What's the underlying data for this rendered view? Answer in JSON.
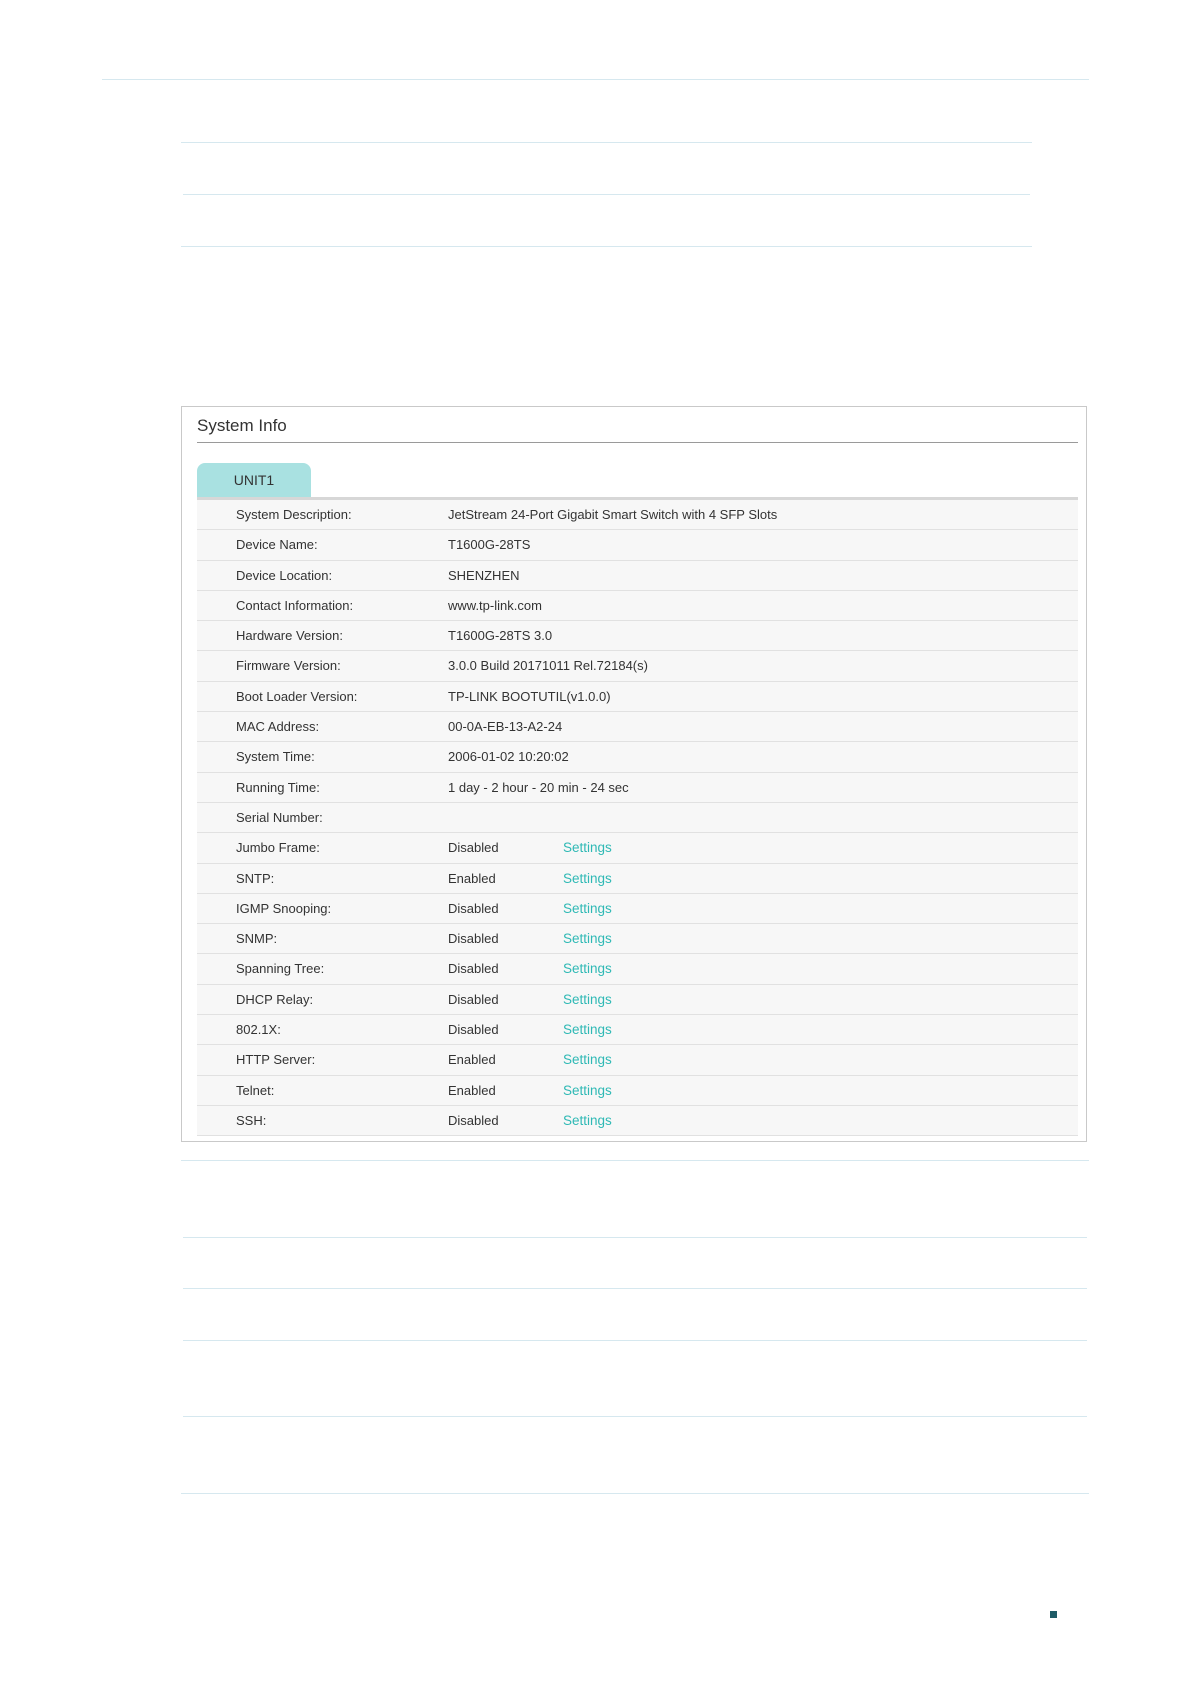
{
  "panel": {
    "title": "System Info",
    "tab_label": "UNIT1"
  },
  "rows": [
    {
      "label": "System Description:",
      "value": "JetStream 24-Port Gigabit Smart Switch with 4 SFP Slots",
      "action": ""
    },
    {
      "label": "Device Name:",
      "value": "T1600G-28TS",
      "action": ""
    },
    {
      "label": "Device Location:",
      "value": "SHENZHEN",
      "action": ""
    },
    {
      "label": "Contact Information:",
      "value": "www.tp-link.com",
      "action": ""
    },
    {
      "label": "Hardware Version:",
      "value": "T1600G-28TS 3.0",
      "action": ""
    },
    {
      "label": "Firmware Version:",
      "value": "3.0.0 Build 20171011 Rel.72184(s)",
      "action": ""
    },
    {
      "label": "Boot Loader Version:",
      "value": "TP-LINK BOOTUTIL(v1.0.0)",
      "action": ""
    },
    {
      "label": "MAC Address:",
      "value": "00-0A-EB-13-A2-24",
      "action": ""
    },
    {
      "label": "System Time:",
      "value": "2006-01-02 10:20:02",
      "action": ""
    },
    {
      "label": "Running Time:",
      "value": "1 day - 2 hour - 20 min - 24 sec",
      "action": ""
    },
    {
      "label": "Serial Number:",
      "value": "",
      "action": ""
    },
    {
      "label": "Jumbo Frame:",
      "value": "Disabled",
      "action": "Settings"
    },
    {
      "label": "SNTP:",
      "value": "Enabled",
      "action": "Settings"
    },
    {
      "label": "IGMP Snooping:",
      "value": "Disabled",
      "action": "Settings"
    },
    {
      "label": "SNMP:",
      "value": "Disabled",
      "action": "Settings"
    },
    {
      "label": "Spanning Tree:",
      "value": "Disabled",
      "action": "Settings"
    },
    {
      "label": "DHCP Relay:",
      "value": "Disabled",
      "action": "Settings"
    },
    {
      "label": "802.1X:",
      "value": "Disabled",
      "action": "Settings"
    },
    {
      "label": "HTTP Server:",
      "value": "Enabled",
      "action": "Settings"
    },
    {
      "label": "Telnet:",
      "value": "Enabled",
      "action": "Settings"
    },
    {
      "label": "SSH:",
      "value": "Disabled",
      "action": "Settings"
    }
  ],
  "colors": {
    "tab_background": "#a9e1e1",
    "link": "#2fb9b5",
    "row_background": "#f7f7f7",
    "rule_lines": "#d6e8ef",
    "corner_mark": "#1e5b66"
  }
}
